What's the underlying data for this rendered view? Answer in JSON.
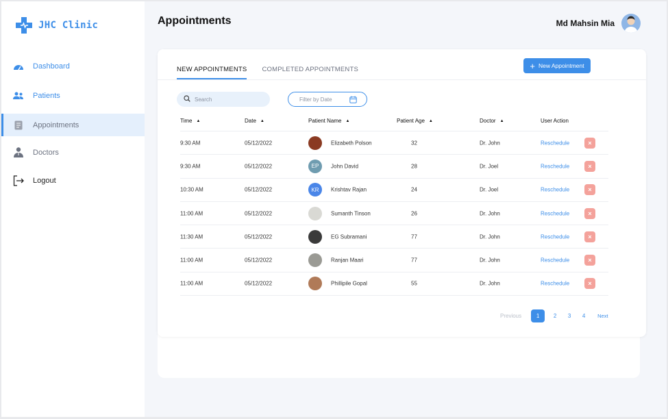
{
  "brand": {
    "name": "JHC Clinic"
  },
  "sidebar": {
    "items": [
      {
        "label": "Dashboard",
        "icon": "dashboard-icon"
      },
      {
        "label": "Patients",
        "icon": "patients-icon"
      },
      {
        "label": "Appointments",
        "icon": "appointments-icon",
        "active": true
      },
      {
        "label": "Doctors",
        "icon": "doctor-icon"
      },
      {
        "label": "Logout",
        "icon": "logout-icon"
      }
    ]
  },
  "header": {
    "title": "Appointments",
    "user_name": "Md Mahsin Mia"
  },
  "tabs": [
    {
      "label": "NEW APPOINTMENTS",
      "active": true
    },
    {
      "label": "COMPLETED APPOINTMENTS",
      "active": false
    }
  ],
  "new_button": {
    "label": "New Appointment"
  },
  "search": {
    "placeholder": "Search"
  },
  "filter": {
    "label": "Filter by Date"
  },
  "table": {
    "headers": {
      "time": "Time",
      "date": "Date",
      "patient_name": "Patient Name",
      "patient_age": "Patient Age",
      "doctor": "Doctor",
      "user_action": "User Action"
    },
    "action_label": "Reschedule",
    "rows": [
      {
        "time": "9:30 AM",
        "date": "05/12/2022",
        "initials": "",
        "name": "Elizabeth Polson",
        "age": "32",
        "doctor": "Dr. John",
        "avatar_color": "#8a3a22"
      },
      {
        "time": "9:30 AM",
        "date": "05/12/2022",
        "initials": "EP",
        "name": "John David",
        "age": "28",
        "doctor": "Dr. Joel",
        "avatar_color": "#6f9cb0"
      },
      {
        "time": "10:30 AM",
        "date": "05/12/2022",
        "initials": "KR",
        "name": "Krishtav Rajan",
        "age": "24",
        "doctor": "Dr. Joel",
        "avatar_color": "#4a86e8"
      },
      {
        "time": "11:00 AM",
        "date": "05/12/2022",
        "initials": "",
        "name": "Sumanth Tinson",
        "age": "26",
        "doctor": "Dr. John",
        "avatar_color": "#d9d9d4"
      },
      {
        "time": "11:30 AM",
        "date": "05/12/2022",
        "initials": "",
        "name": "EG Subramani",
        "age": "77",
        "doctor": "Dr. John",
        "avatar_color": "#3a3a3a"
      },
      {
        "time": "11:00 AM",
        "date": "05/12/2022",
        "initials": "",
        "name": "Ranjan Maari",
        "age": "77",
        "doctor": "Dr. John",
        "avatar_color": "#9a9a94"
      },
      {
        "time": "11:00 AM",
        "date": "05/12/2022",
        "initials": "",
        "name": "Phillipile Gopal",
        "age": "55",
        "doctor": "Dr. John",
        "avatar_color": "#b07a58"
      }
    ]
  },
  "pagination": {
    "prev": "Previous",
    "pages": [
      "1",
      "2",
      "3",
      "4"
    ],
    "current": "1",
    "next": "Next"
  },
  "colors": {
    "accent": "#3d8ee8",
    "cancel": "#f4a29b",
    "background": "#f4f6fa"
  }
}
